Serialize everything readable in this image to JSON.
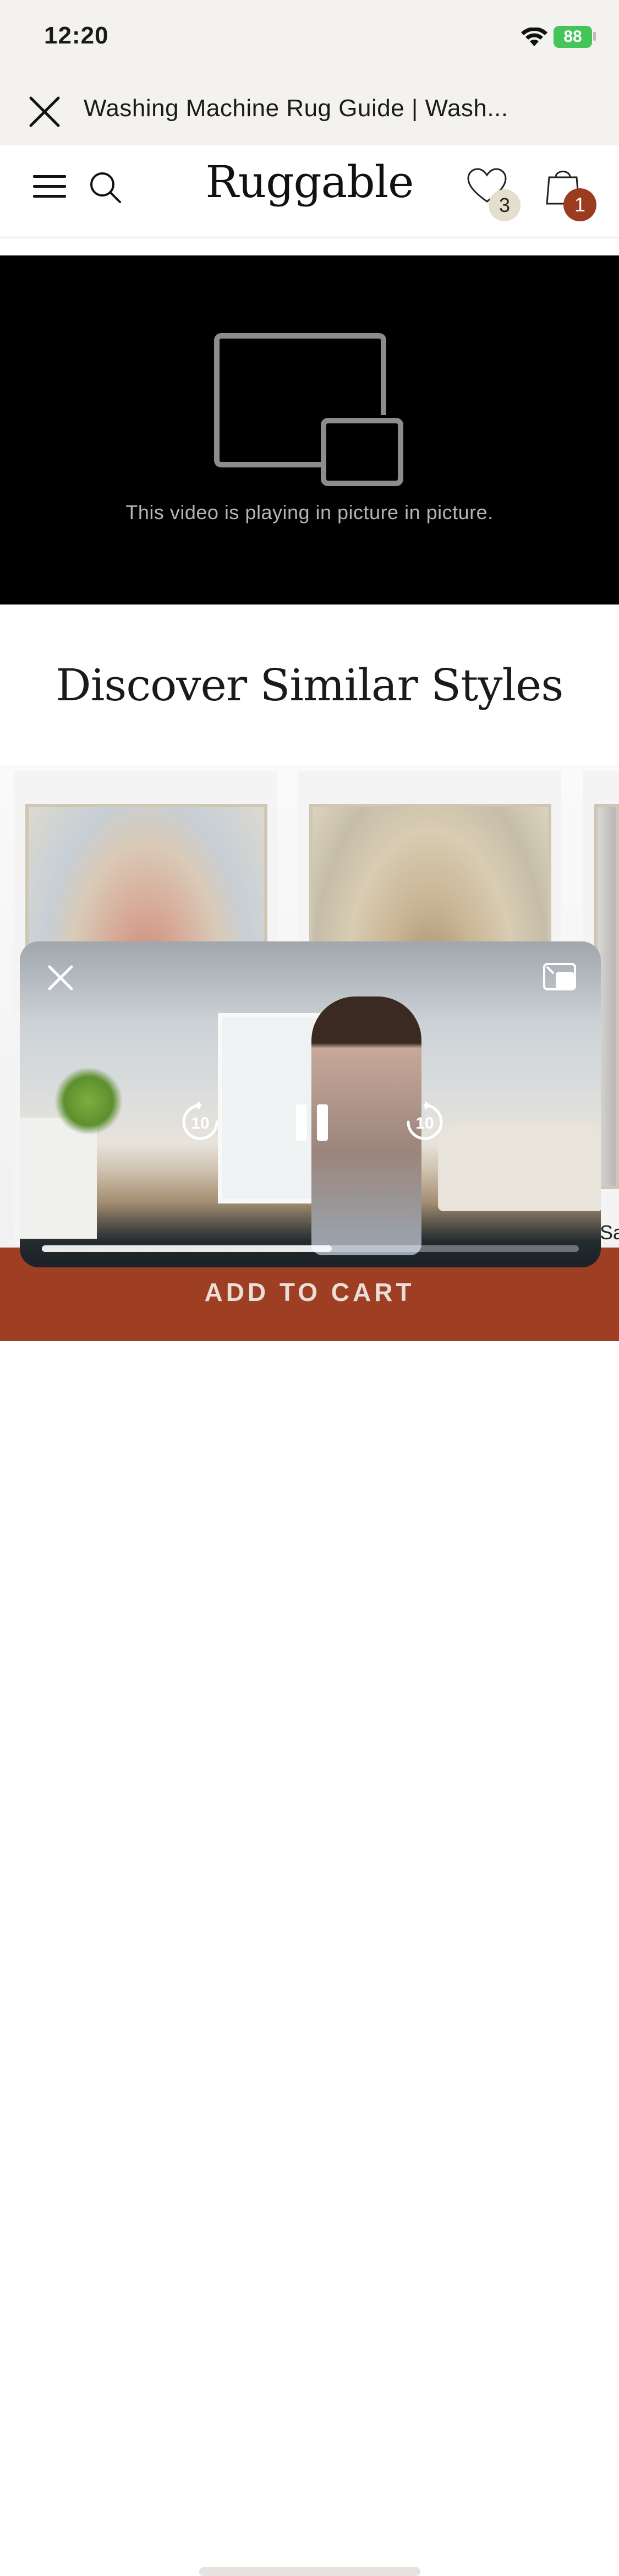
{
  "status_bar": {
    "time": "12:20",
    "battery": "88"
  },
  "browser": {
    "title": "Washing Machine Rug Guide | Wash..."
  },
  "header": {
    "logo": "Ruggable",
    "wishlist_count": "3",
    "cart_count": "1"
  },
  "video": {
    "pip_message": "This video is playing in picture in picture."
  },
  "section": {
    "heading": "Discover Similar Styles"
  },
  "pip_player": {
    "skip_back_label": "10",
    "skip_forward_label": "10",
    "progress": 0.54
  },
  "peek_text": "Sa",
  "cta": {
    "add_to_cart": "ADD TO CART"
  },
  "colors": {
    "accent": "#9e3e23",
    "badge": "#9b3b1f",
    "wishlist_badge": "#e4dfcc",
    "battery": "#45c45a"
  }
}
